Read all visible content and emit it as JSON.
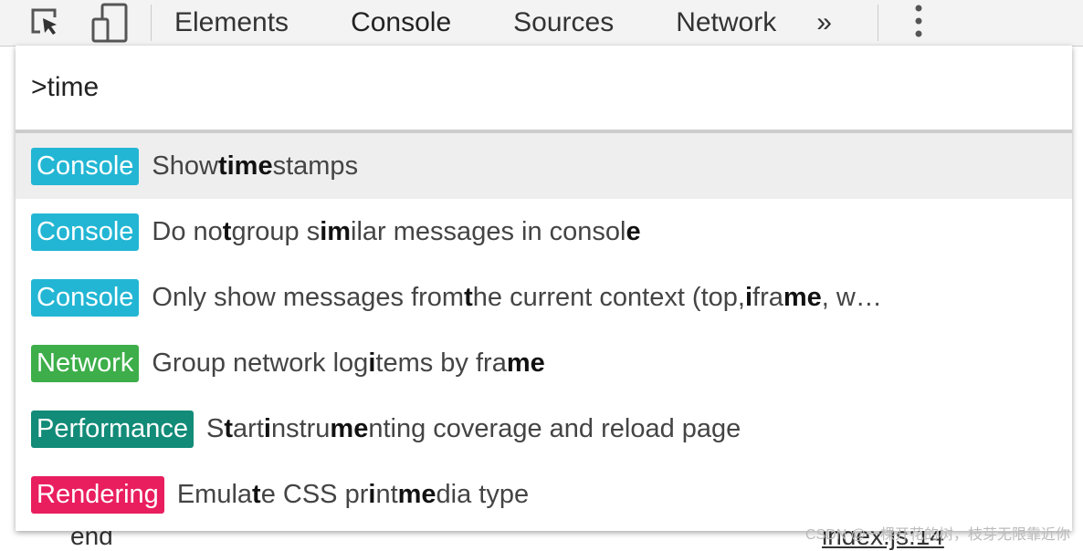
{
  "toolbar": {
    "tabs": [
      "Elements",
      "Console",
      "Sources",
      "Network"
    ],
    "more": "»",
    "active": "Console"
  },
  "background": {
    "text": "end",
    "link": "index.js:14"
  },
  "palette": {
    "query": ">time",
    "selected_index": 0,
    "items": [
      {
        "category": "Console",
        "color": "#22b6d4",
        "segments": [
          {
            "t": "Show ",
            "b": false
          },
          {
            "t": "time",
            "b": true
          },
          {
            "t": "stamps",
            "b": false
          }
        ]
      },
      {
        "category": "Console",
        "color": "#22b6d4",
        "segments": [
          {
            "t": "Do no",
            "b": false
          },
          {
            "t": "t",
            "b": true
          },
          {
            "t": " group s",
            "b": false
          },
          {
            "t": "im",
            "b": true
          },
          {
            "t": "ilar messages in consol",
            "b": false
          },
          {
            "t": "e",
            "b": true
          }
        ]
      },
      {
        "category": "Console",
        "color": "#22b6d4",
        "segments": [
          {
            "t": "Only show messages from ",
            "b": false
          },
          {
            "t": "t",
            "b": true
          },
          {
            "t": "he current context (top, ",
            "b": false
          },
          {
            "t": "i",
            "b": true
          },
          {
            "t": "fra",
            "b": false
          },
          {
            "t": "me",
            "b": true
          },
          {
            "t": ", w…",
            "b": false
          }
        ]
      },
      {
        "category": "Network",
        "color": "#3dae49",
        "segments": [
          {
            "t": "Group network log ",
            "b": false
          },
          {
            "t": "i",
            "b": true
          },
          {
            "t": "tems by fra",
            "b": false
          },
          {
            "t": "me",
            "b": true
          }
        ]
      },
      {
        "category": "Performance",
        "color": "#128b78",
        "segments": [
          {
            "t": "S",
            "b": false
          },
          {
            "t": "t",
            "b": true
          },
          {
            "t": "art ",
            "b": false
          },
          {
            "t": "i",
            "b": true
          },
          {
            "t": "nstru",
            "b": false
          },
          {
            "t": "me",
            "b": true
          },
          {
            "t": "nting coverage and reload page",
            "b": false
          }
        ]
      },
      {
        "category": "Rendering",
        "color": "#e91e5f",
        "segments": [
          {
            "t": "Emula",
            "b": false
          },
          {
            "t": "t",
            "b": true
          },
          {
            "t": "e CSS pr",
            "b": false
          },
          {
            "t": "i",
            "b": true
          },
          {
            "t": "nt ",
            "b": false
          },
          {
            "t": "me",
            "b": true
          },
          {
            "t": "dia type",
            "b": false
          }
        ]
      }
    ]
  },
  "watermark": "CSDN @一棵开花的树，枝芽无限靠近你"
}
